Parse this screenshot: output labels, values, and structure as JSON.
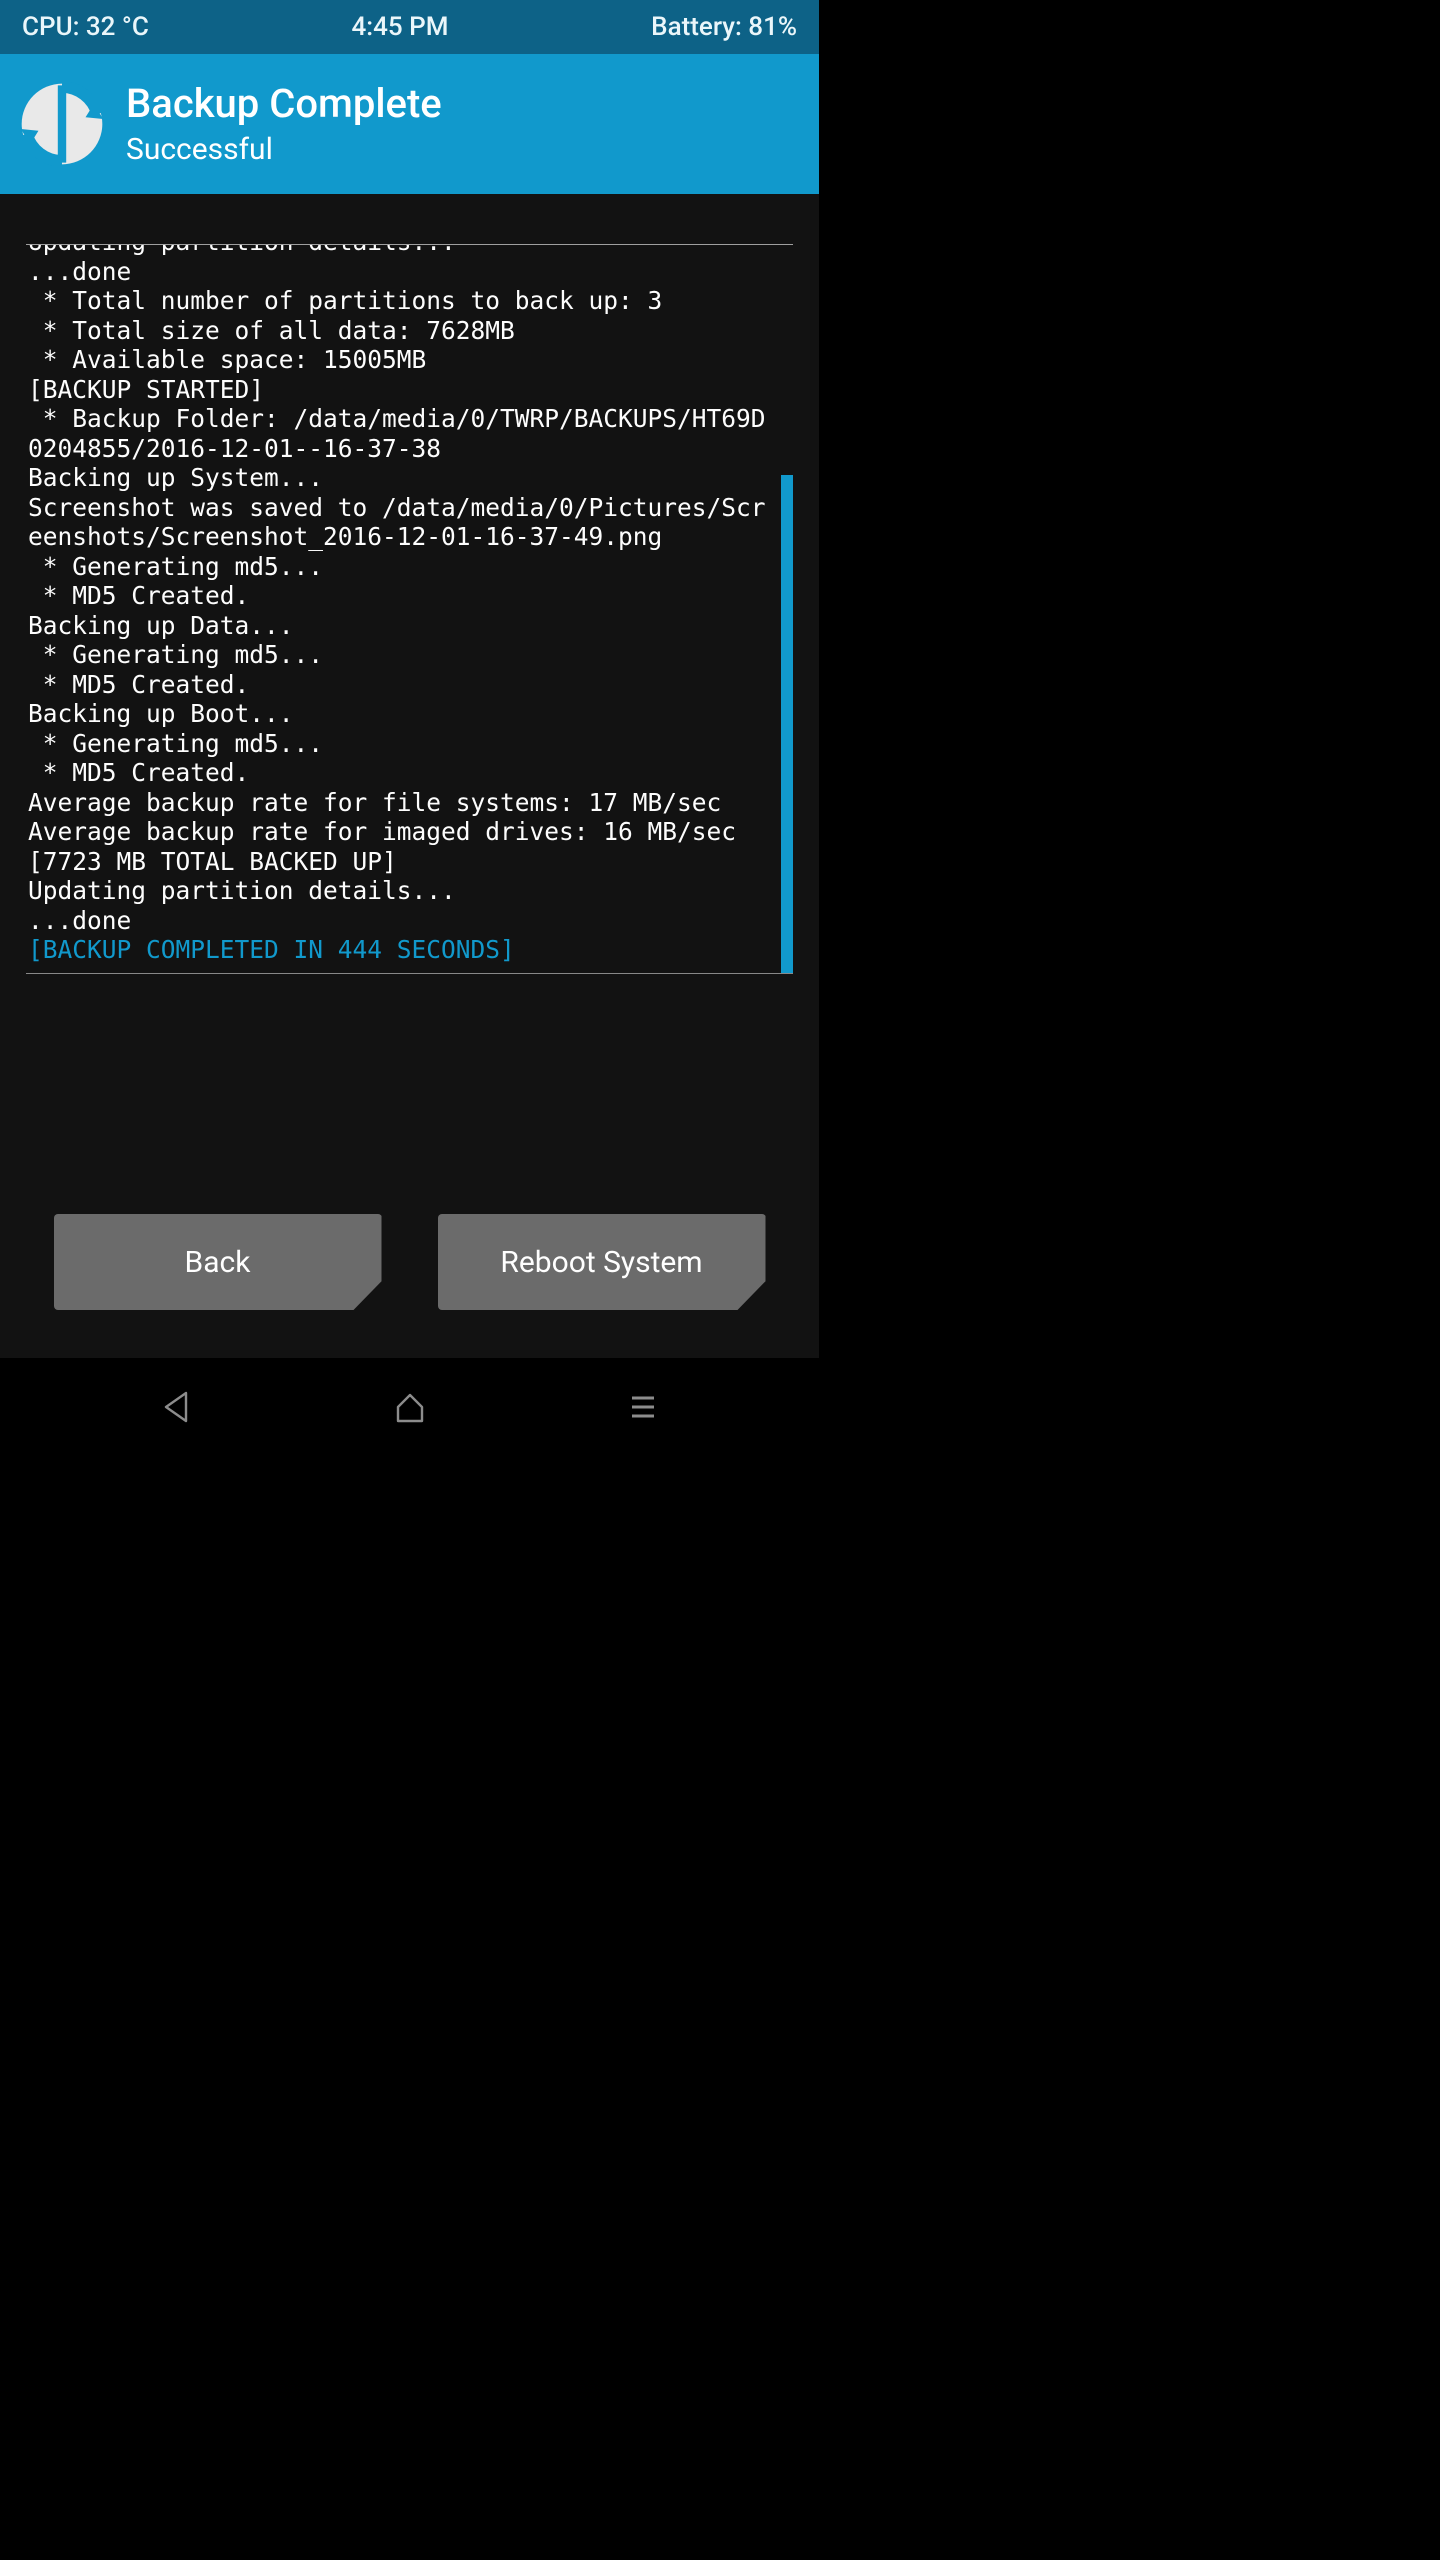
{
  "statusbar": {
    "cpu": "CPU: 32 °C",
    "time": "4:45 PM",
    "battery": "Battery: 81%"
  },
  "header": {
    "title": "Backup Complete",
    "subtitle": "Successful"
  },
  "log": {
    "lines": [
      "Updating partition details...",
      "...done",
      " * Total number of partitions to back up: 3",
      " * Total size of all data: 7628MB",
      " * Available space: 15005MB",
      "[BACKUP STARTED]",
      " * Backup Folder: /data/media/0/TWRP/BACKUPS/HT69D0204855/2016-12-01--16-37-38",
      "Backing up System...",
      "Screenshot was saved to /data/media/0/Pictures/Screenshots/Screenshot_2016-12-01-16-37-49.png",
      " * Generating md5...",
      " * MD5 Created.",
      "Backing up Data...",
      " * Generating md5...",
      " * MD5 Created.",
      "Backing up Boot...",
      " * Generating md5...",
      " * MD5 Created.",
      "Average backup rate for file systems: 17 MB/sec",
      "Average backup rate for imaged drives: 16 MB/sec",
      "[7723 MB TOTAL BACKED UP]",
      "Updating partition details...",
      "...done"
    ],
    "final": "[BACKUP COMPLETED IN 444 SECONDS]"
  },
  "buttons": {
    "back": "Back",
    "reboot": "Reboot System"
  }
}
